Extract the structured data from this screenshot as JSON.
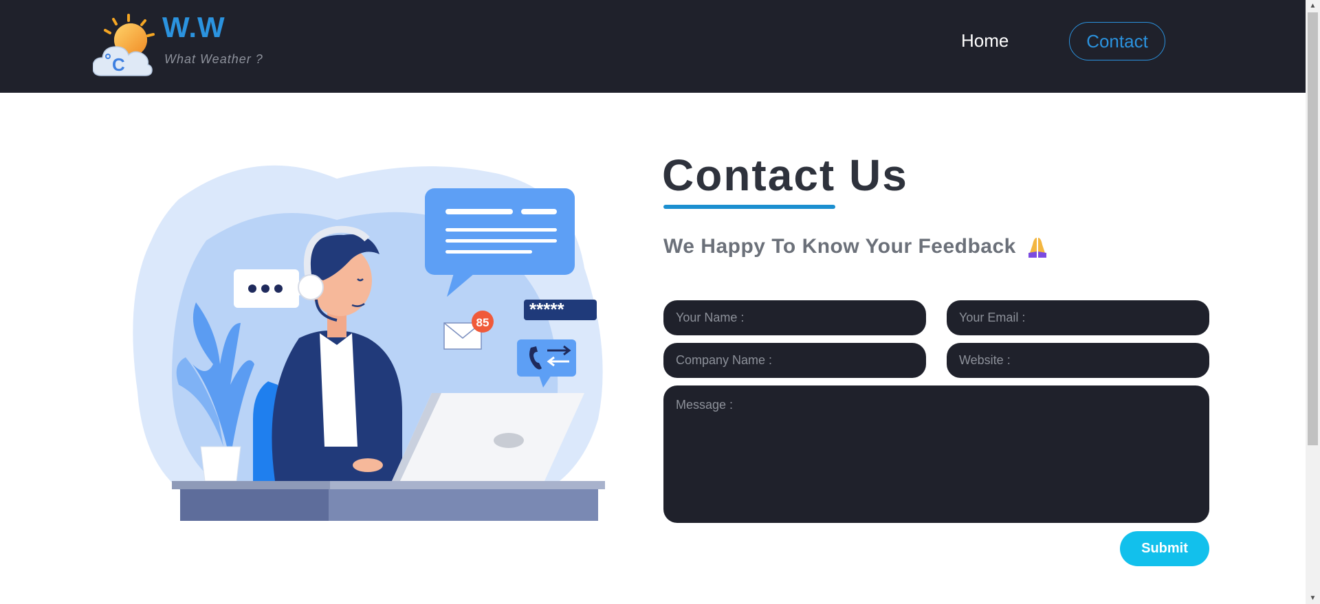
{
  "header": {
    "brand_title": "W.W",
    "brand_subtitle": "What Weather ?",
    "nav": {
      "home_label": "Home",
      "contact_label": "Contact"
    }
  },
  "main": {
    "title": "Contact Us",
    "subtitle": "We Happy To Know Your Feedback",
    "form": {
      "name_placeholder": "Your Name :",
      "email_placeholder": "Your Email :",
      "company_placeholder": "Company Name :",
      "website_placeholder": "Website :",
      "message_placeholder": "Message :",
      "submit_label": "Submit"
    },
    "illustration": {
      "badge_count": "85",
      "password_mask": "*****"
    }
  },
  "icons": {
    "logo": "weather-logo-icon",
    "subtitle_emoji": "praying-hands-icon"
  },
  "colors": {
    "header_bg": "#1f212b",
    "accent_blue": "#2b93df",
    "title_underline": "#1c8fd0",
    "submit_bg": "#12c0ec",
    "field_bg": "#1f212b"
  }
}
